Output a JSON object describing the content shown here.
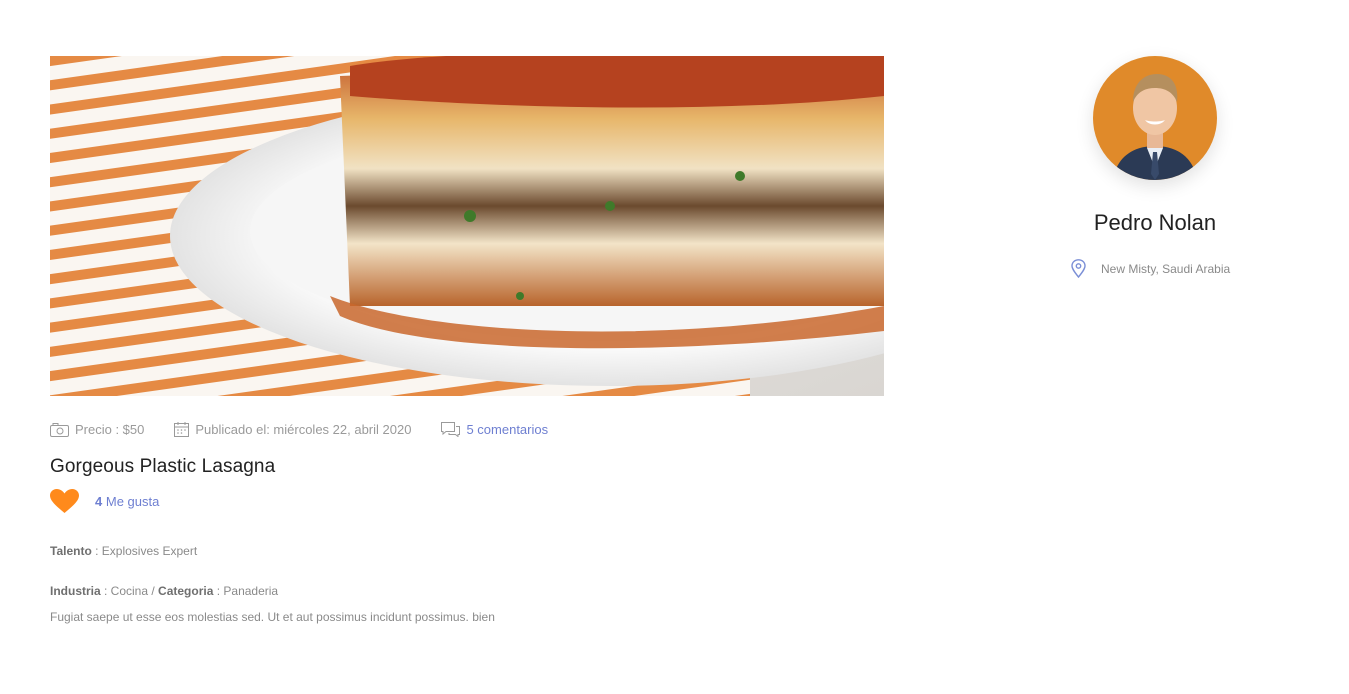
{
  "post": {
    "image_icon": "lasagna-photo",
    "price_label": "Precio : $50",
    "published_label": "Publicado el: miércoles 22, abril 2020",
    "comments_label": "5 comentarios",
    "title": "Gorgeous Plastic Lasagna",
    "likes_count": "4",
    "likes_label": "Me gusta",
    "talent_key": "Talento",
    "talent_value": " : Explosives Expert",
    "industry_key": "Industria",
    "industry_value": " : Cocina / ",
    "category_key": "Categoria",
    "category_value": " : Panaderia",
    "description": "Fugiat saepe ut esse eos molestias sed. Ut et aut possimus incidunt possimus. bien"
  },
  "profile": {
    "avatar_icon": "user-avatar",
    "name": "Pedro Nolan",
    "location": "New Misty, Saudi Arabia"
  },
  "colors": {
    "accent_link": "#6e7fd1",
    "heart": "#ff8a1c",
    "avatar_bg": "#e08a2a"
  }
}
